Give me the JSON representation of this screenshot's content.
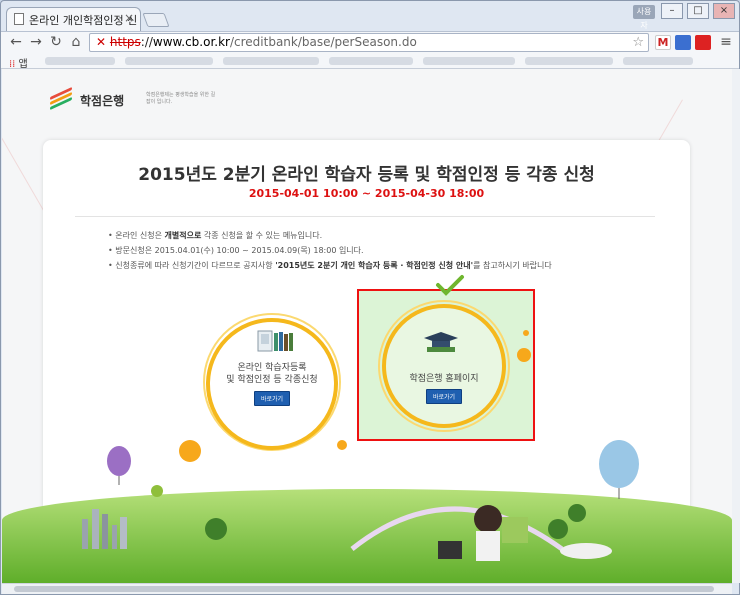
{
  "browser": {
    "tab_title": "온라인 개인학점인정 신",
    "url_scheme": "https",
    "url_sep": "://",
    "url_host": "www.cb.or.kr",
    "url_path": "/creditbank/base/perSeason.do",
    "apps_label": "앱",
    "user_badge": "사용자"
  },
  "site": {
    "logo_name": "학점은행",
    "logo_tagline": "학점은행제는 평생학습을 위한 길잡이 입니다."
  },
  "page": {
    "title": "2015년도 2분기 온라인 학습자 등록 및 학점인정 등 각종 신청",
    "period": "2015-04-01 10:00 ~ 2015-04-30 18:00",
    "notice_1_pre": "온라인 신청은 ",
    "notice_1_bold": "개별적으로",
    "notice_1_post": " 각종 신청을 할 수 있는 메뉴입니다.",
    "notice_2": "방문신청은 2015.04.01(수) 10:00 ~ 2015.04.09(목) 18:00 입니다.",
    "notice_3_pre": "신청종류에 따라 신청기간이 다르므로 공지사항 ",
    "notice_3_bold": "'2015년도 2분기 개인 학습자 등록 · 학점인정 신청 안내'",
    "notice_3_post": "를 참고하시기 바랍니다"
  },
  "options": [
    {
      "label_line1": "온라인 학습자등록",
      "label_line2": "및 학점인정 등 각종신청",
      "button": "바로가기"
    },
    {
      "label": "학점은행 홈페이지",
      "button": "바로가기"
    }
  ],
  "colors": {
    "accent_orange": "#f5b81c",
    "highlight_red": "#e11111",
    "button_blue": "#1f5fb0",
    "period_red": "#dd1111"
  }
}
